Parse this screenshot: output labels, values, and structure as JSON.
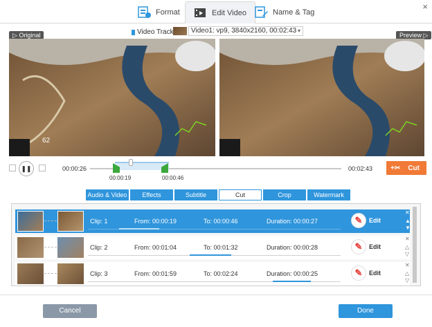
{
  "tabs": {
    "format": "Format",
    "edit_video": "Edit Video",
    "name_tag": "Name & Tag"
  },
  "window": {
    "close": "×"
  },
  "track": {
    "label": "Video Track:",
    "value": "Video1: vp9, 3840x2160, 00:02:43"
  },
  "panes": {
    "original": "Original",
    "preview": "Preview"
  },
  "playback": {
    "time_start": "00:00:26",
    "time_end": "00:02:43",
    "sel_start": "00:00:19",
    "sel_end": "00:00:46",
    "cut_label": "Cut"
  },
  "edit_tabs": [
    "Audio & Video",
    "Effects",
    "Subtitle",
    "Cut",
    "Crop",
    "Watermark"
  ],
  "active_edit_tab": "Cut",
  "clips": [
    {
      "name": "Clip: 1",
      "from": "From:  00:00:19",
      "to": "To:  00:00:46",
      "duration": "Duration:  00:00:27",
      "edit": "Edit"
    },
    {
      "name": "Clip: 2",
      "from": "From:  00:01:04",
      "to": "To:  00:01:32",
      "duration": "Duration:  00:00:28",
      "edit": "Edit"
    },
    {
      "name": "Clip: 3",
      "from": "From:  00:01:59",
      "to": "To:  00:02:24",
      "duration": "Duration:  00:00:25",
      "edit": "Edit"
    }
  ],
  "footer": {
    "cancel": "Cancel",
    "done": "Done"
  },
  "colors": {
    "accent": "#2f95dc",
    "cut": "#f07a36",
    "handle": "#3ca83c"
  }
}
